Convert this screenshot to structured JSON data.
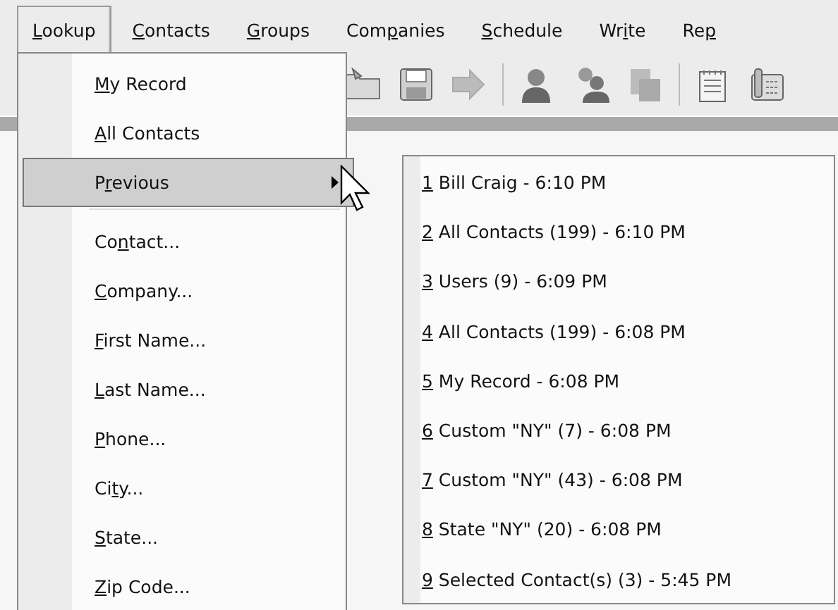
{
  "menubar": [
    {
      "key": "L",
      "post": "ookup",
      "selected": true
    },
    {
      "key": "C",
      "post": "ontacts",
      "selected": false
    },
    {
      "key": "G",
      "post": "roups",
      "selected": false
    },
    {
      "pre": "Com",
      "key": "p",
      "post": "anies",
      "selected": false
    },
    {
      "key": "S",
      "post": "chedule",
      "selected": false
    },
    {
      "pre": "Wr",
      "key": "i",
      "post": "te",
      "selected": false
    },
    {
      "pre": "Re",
      "key": "p",
      "selected": false
    }
  ],
  "lookup_menu": [
    {
      "kind": "item",
      "key": "M",
      "post": "y Record",
      "selected": false
    },
    {
      "kind": "item",
      "key": "A",
      "post": "ll Contacts",
      "selected": false
    },
    {
      "kind": "submenu",
      "pre": "P",
      "key": "r",
      "post": "evious",
      "selected": true
    },
    {
      "kind": "separator"
    },
    {
      "kind": "item",
      "pre": "Co",
      "key": "n",
      "post": "tact...",
      "selected": false
    },
    {
      "kind": "item",
      "key": "C",
      "post": "ompany...",
      "selected": false
    },
    {
      "kind": "item",
      "key": "F",
      "post": "irst Name...",
      "selected": false
    },
    {
      "kind": "item",
      "key": "L",
      "post": "ast Name...",
      "selected": false
    },
    {
      "kind": "item",
      "key": "P",
      "post": "hone...",
      "selected": false
    },
    {
      "kind": "item",
      "pre": "Ci",
      "key": "t",
      "post": "y...",
      "selected": false
    },
    {
      "kind": "item",
      "key": "S",
      "post": "tate...",
      "selected": false
    },
    {
      "kind": "item",
      "key": "Z",
      "post": "ip Code...",
      "selected": false
    }
  ],
  "previous_menu": [
    {
      "key": "1",
      "post": " Bill Craig - 6:10 PM",
      "selected": false
    },
    {
      "key": "2",
      "post": " All Contacts (199) - 6:10 PM",
      "selected": false
    },
    {
      "key": "3",
      "post": " Users (9) - 6:09 PM",
      "selected": false
    },
    {
      "key": "4",
      "post": " All Contacts (199) - 6:08 PM",
      "selected": false
    },
    {
      "key": "5",
      "post": " My Record - 6:08 PM",
      "selected": false
    },
    {
      "key": "6",
      "post": " Custom \"NY\" (7) - 6:08 PM",
      "selected": false
    },
    {
      "key": "7",
      "post": " Custom \"NY\" (43) - 6:08 PM",
      "selected": false
    },
    {
      "key": "8",
      "post": " State \"NY\" (20) - 6:08 PM",
      "selected": false
    },
    {
      "key": "9",
      "post": " Selected Contact(s) (3) - 5:45 PM",
      "selected": false
    }
  ]
}
